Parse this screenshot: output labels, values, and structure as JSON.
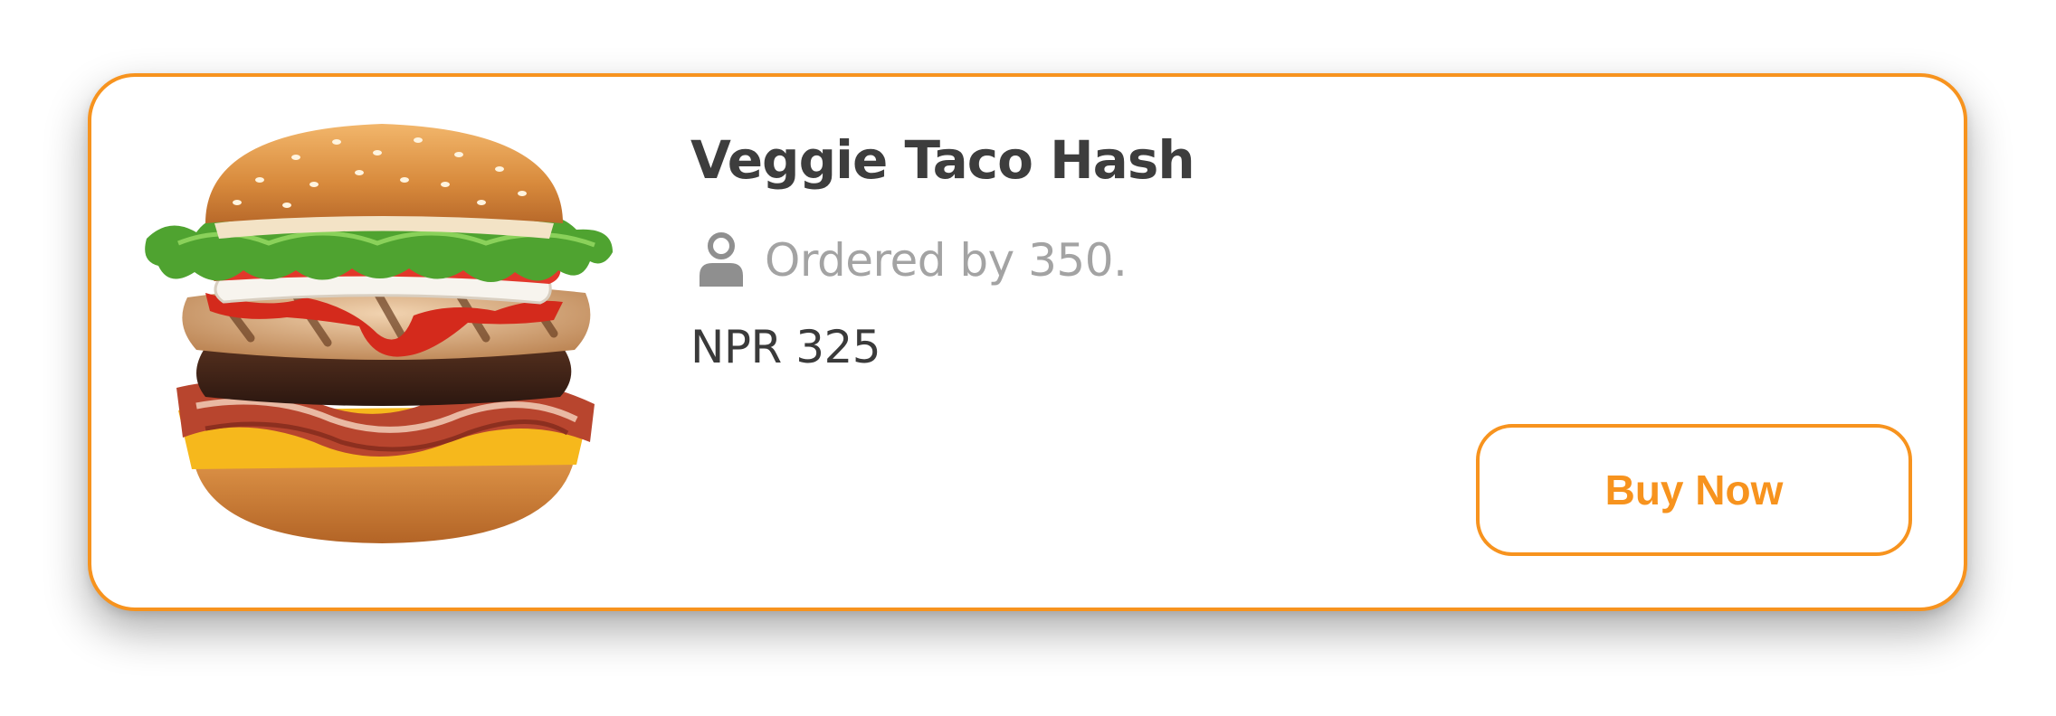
{
  "product": {
    "name": "Veggie Taco Hash",
    "ordered_text": "Ordered by 350.",
    "price": "NPR 325",
    "image_icon": "burger-image",
    "user_icon": "user-icon"
  },
  "actions": {
    "buy_label": "Buy Now"
  },
  "colors": {
    "accent": "#F7931E",
    "title": "#3D3D3D",
    "muted": "#A3A3A3",
    "price": "#3A3A3A",
    "background": "#FFFFFF"
  }
}
